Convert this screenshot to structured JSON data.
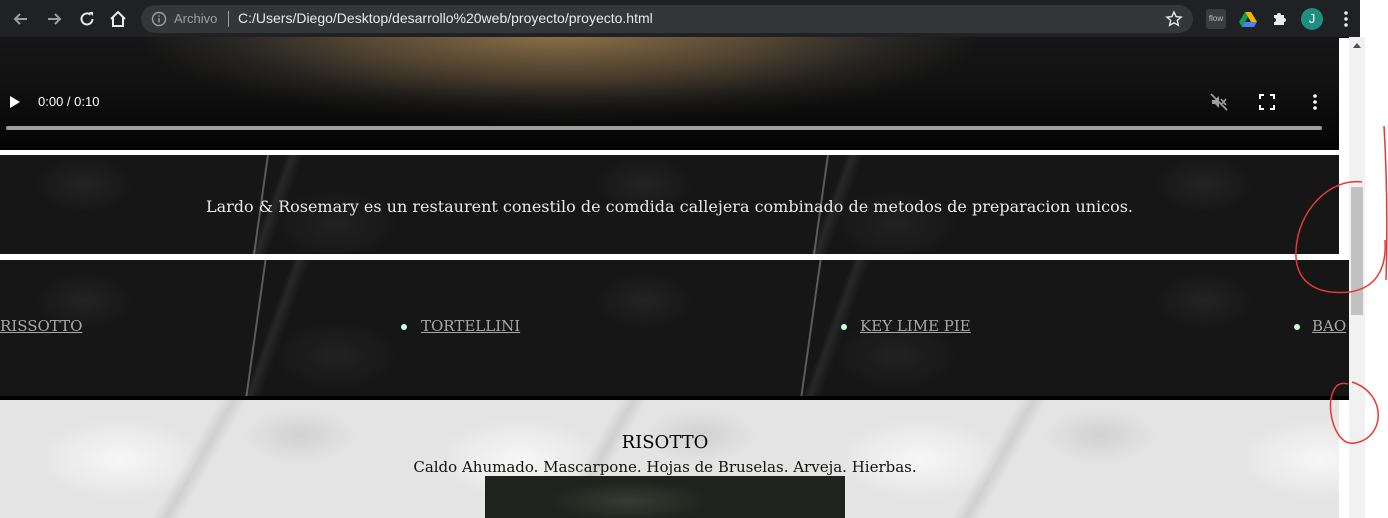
{
  "browser": {
    "back_icon": "arrow-left-icon",
    "forward_icon": "arrow-right-icon",
    "reload_icon": "reload-icon",
    "home_icon": "home-icon",
    "scheme_label": "Archivo",
    "url": "C:/Users/Diego/Desktop/desarrollo%20web/proyecto/proyecto.html",
    "flow_extension_label": "flow",
    "profile_initial": "J",
    "colors": {
      "chrome_bg": "#202124",
      "omnibox_bg": "#35363a",
      "avatar_bg": "#1e8e7e"
    }
  },
  "video": {
    "time_display": "0:00 / 0:10",
    "progress": 0,
    "muted": true
  },
  "intro": {
    "tagline": "Lardo & Rosemary es un restaurent conestilo de comdida callejera combinado de metodos de preparacion unicos."
  },
  "menu": {
    "items": [
      {
        "label": "RISSOTTO"
      },
      {
        "label": "TORTELLINI"
      },
      {
        "label": "KEY LIME PIE"
      },
      {
        "label": "BAO"
      }
    ],
    "bullet_color": "#c9ffd3"
  },
  "dish": {
    "title": "RISOTTO",
    "description": "Caldo Ahumado. Mascarpone. Hojas de Bruselas. Arveja. Hierbas."
  }
}
